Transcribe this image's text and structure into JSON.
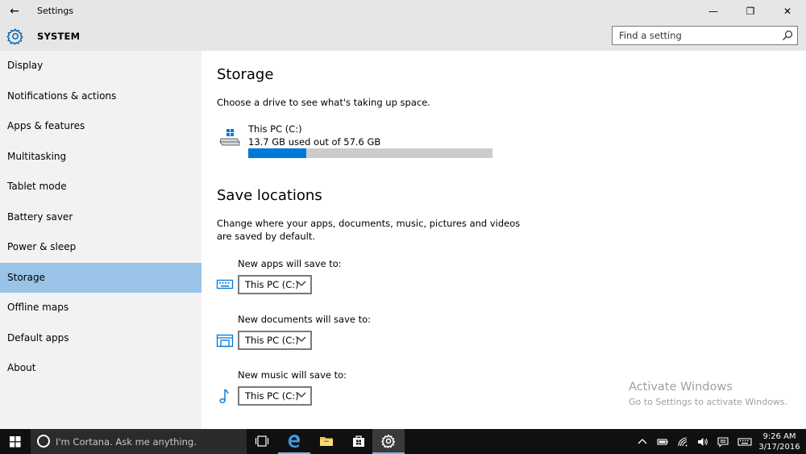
{
  "window": {
    "title": "Settings",
    "back_glyph": "←",
    "min_glyph": "—",
    "max_glyph": "❐",
    "close_glyph": "✕"
  },
  "header": {
    "section_title": "SYSTEM",
    "search_placeholder": "Find a setting"
  },
  "sidebar": {
    "items": [
      {
        "label": "Display"
      },
      {
        "label": "Notifications & actions"
      },
      {
        "label": "Apps & features"
      },
      {
        "label": "Multitasking"
      },
      {
        "label": "Tablet mode"
      },
      {
        "label": "Battery saver"
      },
      {
        "label": "Power & sleep"
      },
      {
        "label": "Storage"
      },
      {
        "label": "Offline maps"
      },
      {
        "label": "Default apps"
      },
      {
        "label": "About"
      }
    ],
    "active_index": 7
  },
  "storage": {
    "title": "Storage",
    "description": "Choose a drive to see what's taking up space.",
    "drive_name": "This PC (C:)",
    "drive_usage": "13.7 GB used out of 57.6 GB",
    "used_fraction": 0.238
  },
  "save_locations": {
    "title": "Save locations",
    "description_line1": "Change where your apps, documents, music, pictures and videos",
    "description_line2": "are saved by default.",
    "apps_label": "New apps will save to:",
    "apps_value": "This PC (C:)",
    "documents_label": "New documents will save to:",
    "documents_value": "This PC (C:)",
    "music_label": "New music will save to:",
    "music_value": "This PC (C:)"
  },
  "watermark": {
    "title": "Activate Windows",
    "subtitle": "Go to Settings to activate Windows."
  },
  "taskbar": {
    "cortana_text": "I'm Cortana. Ask me anything.",
    "time": "9:26 AM",
    "date": "3/17/2016"
  },
  "colors": {
    "accent": "#0078d7",
    "nav_selected": "#99c4e8",
    "taskbar": "#101010"
  }
}
